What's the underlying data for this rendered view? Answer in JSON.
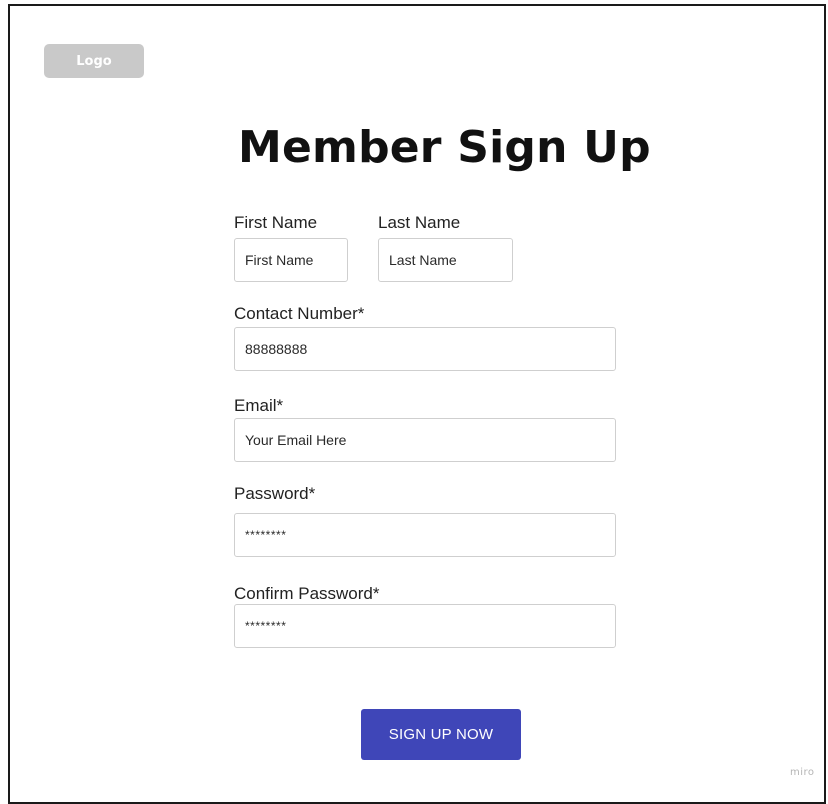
{
  "header": {
    "logo_text": "Logo",
    "title": "Member Sign Up"
  },
  "form": {
    "first_name": {
      "label": "First Name",
      "placeholder": "First Name",
      "value": ""
    },
    "last_name": {
      "label": "Last Name",
      "placeholder": "Last Name",
      "value": ""
    },
    "contact_number": {
      "label": "Contact Number*",
      "value": "88888888"
    },
    "email": {
      "label": "Email*",
      "placeholder": "Your Email Here",
      "value": ""
    },
    "password": {
      "label": "Password*",
      "value": "********"
    },
    "confirm_password": {
      "label": "Confirm Password*",
      "value": "********"
    },
    "submit_label": "SIGN UP NOW"
  },
  "footer": {
    "watermark": "miro"
  },
  "colors": {
    "button_bg": "#3f46b8",
    "logo_bg": "#c9c9c9"
  }
}
